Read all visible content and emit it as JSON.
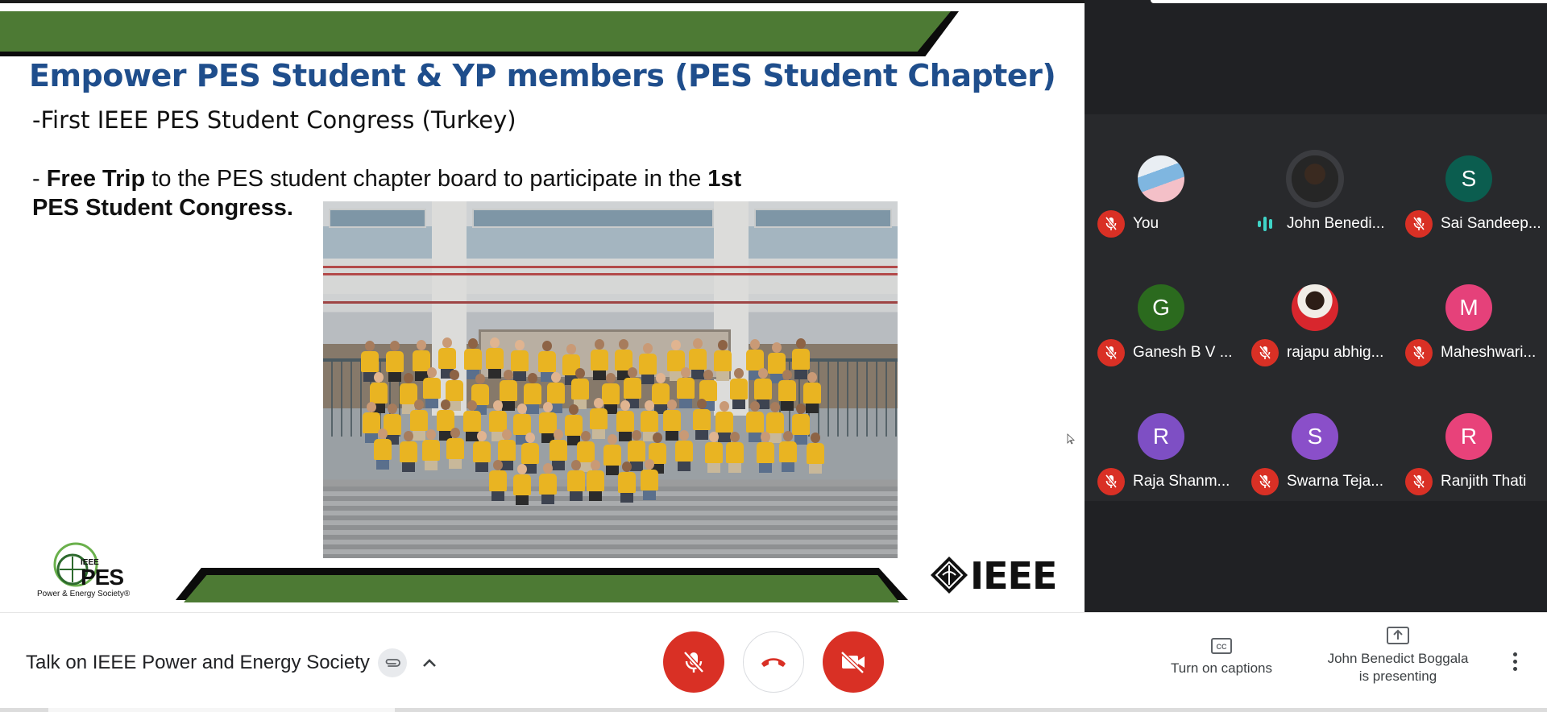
{
  "slide": {
    "title": "Empower PES Student & YP members  (PES Student Chapter)",
    "subtitle": "-First IEEE PES Student Congress (Turkey)",
    "bullet": {
      "prefix": "- ",
      "bold1": "Free Trip",
      "middle": " to the PES student chapter board to participate in the ",
      "bold2": "1st PES Student Congress."
    },
    "pes_logo": {
      "ieee": "IEEE",
      "pes": "PES",
      "subtitle": "Power & Energy Society®"
    },
    "ieee_logo": "IEEE",
    "colors": {
      "title": "#1f4e8c",
      "banner_green": "#4d7a34",
      "banner_black": "#0b0b0b"
    }
  },
  "participants": [
    {
      "name": "You",
      "avatar": "photo",
      "mic": "muted"
    },
    {
      "name": "John Benedi...",
      "avatar": "photo",
      "mic": "speaking"
    },
    {
      "name": "Sai Sandeep...",
      "avatar": "S",
      "color": "#0b5d4f",
      "mic": "muted"
    },
    {
      "name": "Ganesh B V ...",
      "avatar": "G",
      "color": "#2b6a1e",
      "mic": "muted"
    },
    {
      "name": "rajapu abhig...",
      "avatar": "photo",
      "mic": "muted"
    },
    {
      "name": "Maheshwari...",
      "avatar": "M",
      "color": "#e5417a",
      "mic": "muted"
    },
    {
      "name": "Raja Shanm...",
      "avatar": "R",
      "color": "#7e4fc4",
      "mic": "muted"
    },
    {
      "name": "Swarna Teja...",
      "avatar": "S",
      "color": "#8a4fc9",
      "mic": "muted"
    },
    {
      "name": "Ranjith Thati",
      "avatar": "R",
      "color": "#e8427a",
      "mic": "muted"
    }
  ],
  "bottom_bar": {
    "meeting_title": "Talk on IEEE Power and Energy Society",
    "captions_label": "Turn on captions",
    "presenting_line1": "John Benedict Boggala",
    "presenting_line2": "is presenting",
    "colors": {
      "danger": "#d93025"
    }
  }
}
